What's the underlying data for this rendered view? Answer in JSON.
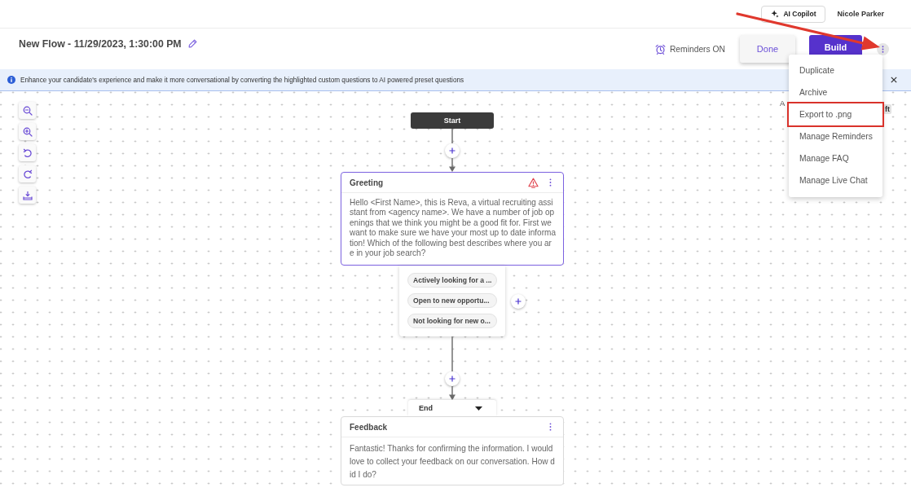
{
  "top_bar": {
    "copilot_button": "AI Copilot",
    "user_name": "Nicole Parker"
  },
  "header": {
    "title": "New Flow - 11/29/2023, 1:30:00 PM",
    "reminders_label": "Reminders ON",
    "buttons": [
      {
        "label": "Done",
        "kind": "secondary"
      },
      {
        "label": "Build",
        "kind": "primary"
      }
    ]
  },
  "banner": {
    "text": "Enhance your candidate's experience and make it more conversational by converting the highlighted custom questions to AI powered preset questions"
  },
  "more_menu": {
    "open": true,
    "items": [
      {
        "label": "Duplicate",
        "highlighted": false
      },
      {
        "label": "Archive",
        "highlighted": false
      },
      {
        "label": "Export to .png",
        "highlighted": true
      },
      {
        "label": "Manage Reminders",
        "highlighted": false
      },
      {
        "label": "Manage FAQ",
        "highlighted": false
      },
      {
        "label": "Manage Live Chat",
        "highlighted": false
      }
    ]
  },
  "annotation_arrow": true,
  "canvas": {
    "label_fragment": "A",
    "badge_fragment": "ft",
    "start": "Start",
    "nodes": [
      {
        "kind": "question",
        "title": "Greeting",
        "selected": true,
        "warning": true,
        "text": "Hello <First Name>, this is Reva, a virtual recruiting assistant from <agency name>. We have a number of job openings that we think you might be a good fit for. First we want to make sure we have your most up to date information! Which of the following best describes where you are in your job search?",
        "options": [
          "Actively looking for a ...",
          "Open to new opportu...",
          "Not looking for new o..."
        ]
      },
      {
        "kind": "message",
        "title": "Feedback",
        "selected": false,
        "warning": false,
        "tab": "End",
        "text": "Fantastic! Thanks for confirming the information. I would love to collect your feedback on our conversation. How did I do?"
      }
    ]
  }
}
